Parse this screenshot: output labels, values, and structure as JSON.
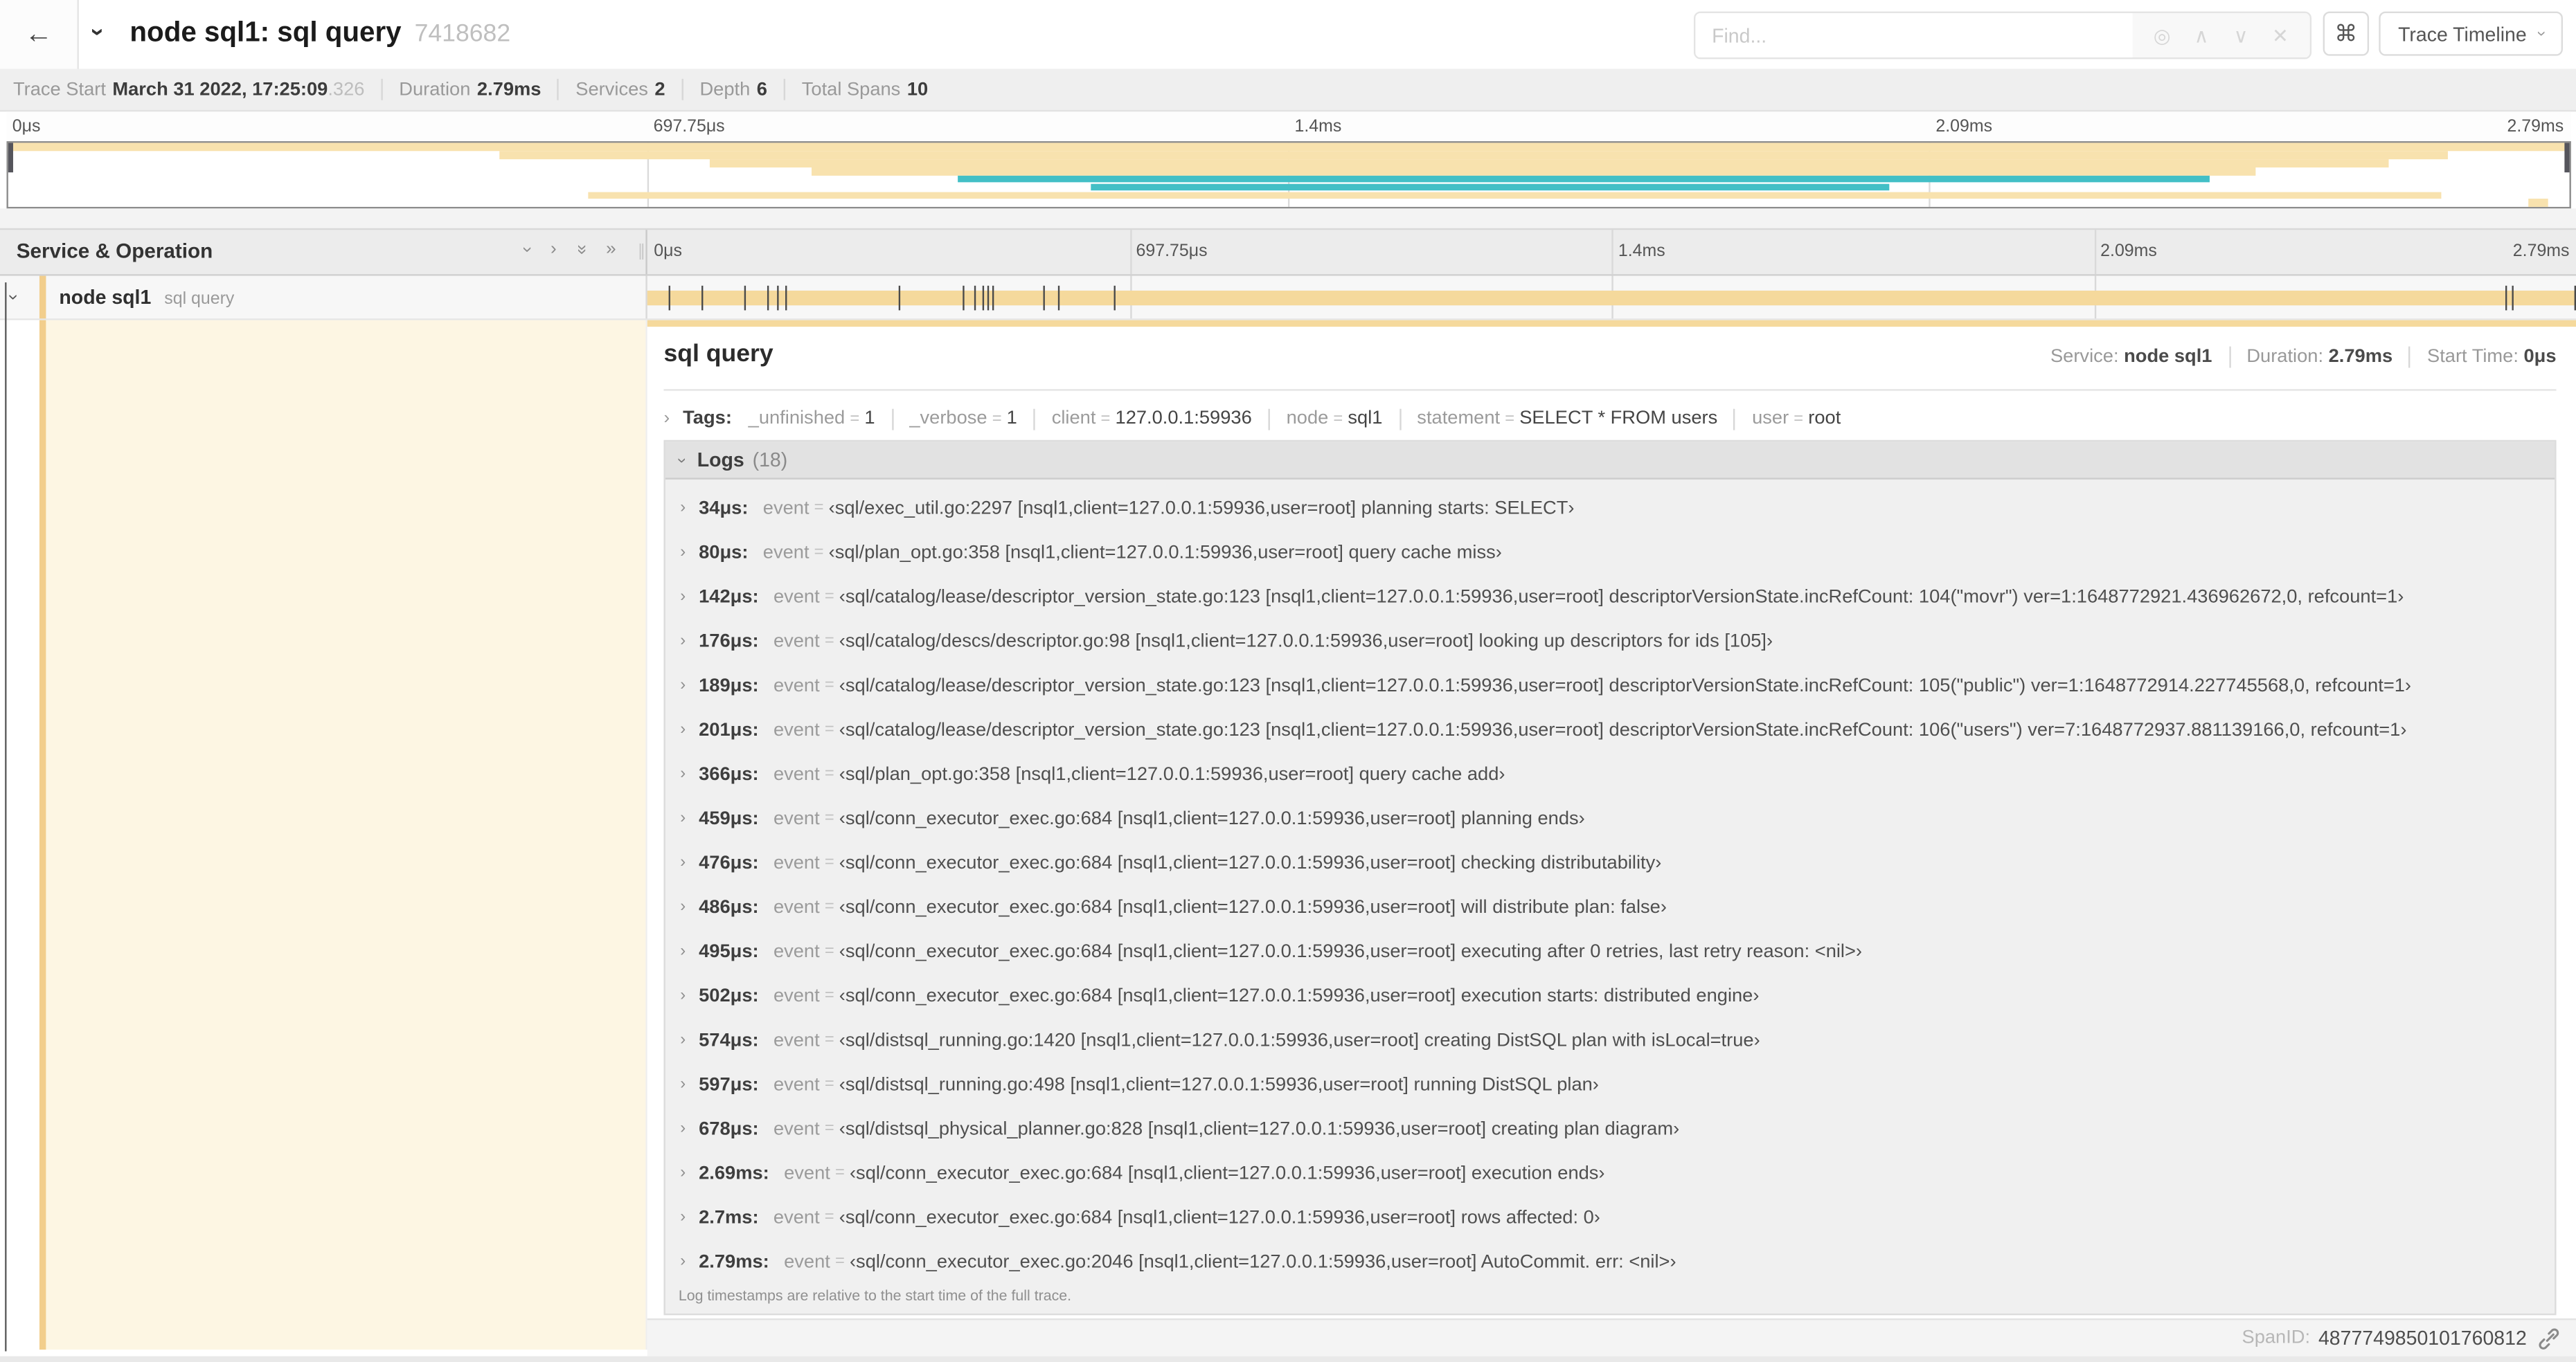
{
  "colors": {
    "span_bar": "#F5D99C",
    "minimap_tan": "#F8E2AE",
    "teal": "#43BFC6",
    "detail_row_bg": "#FDF6E3",
    "accent_bar": "#F2CE8C"
  },
  "header": {
    "back_icon": "←",
    "title": "node sql1: sql query",
    "trace_id": "7418682",
    "find": {
      "placeholder": "Find...",
      "icons": [
        "◎",
        "∧",
        "∨",
        "✕"
      ]
    },
    "shortcuts_button": "⌘",
    "view_button": {
      "label": "Trace Timeline"
    }
  },
  "summary": {
    "items": [
      {
        "label": "Trace Start",
        "value": "March 31 2022, 17:25:09",
        "suffix": ".326"
      },
      {
        "label": "Duration",
        "value": "2.79ms"
      },
      {
        "label": "Services",
        "value": "2"
      },
      {
        "label": "Depth",
        "value": "6"
      },
      {
        "label": "Total Spans",
        "value": "10"
      }
    ]
  },
  "minimap": {
    "tick_labels": [
      "0μs",
      "697.75μs",
      "1.4ms",
      "2.09ms",
      "2.79ms"
    ],
    "gridlines_pct": [
      25,
      50,
      75
    ],
    "spans": [
      {
        "row": 0,
        "start_pct": 0,
        "end_pct": 100,
        "color": "tan"
      },
      {
        "row": 1,
        "start_pct": 19.2,
        "end_pct": 95.3,
        "color": "tan"
      },
      {
        "row": 2,
        "start_pct": 27.4,
        "end_pct": 93.0,
        "color": "tan"
      },
      {
        "row": 3,
        "start_pct": 31.4,
        "end_pct": 87.8,
        "color": "tan"
      },
      {
        "row": 4,
        "start_pct": 37.1,
        "end_pct": 86.0,
        "color": "teal"
      },
      {
        "row": 5,
        "start_pct": 42.3,
        "end_pct": 73.5,
        "color": "teal"
      },
      {
        "row": 6,
        "start_pct": 22.7,
        "end_pct": 95.0,
        "color": "tan"
      },
      {
        "row": 7,
        "start_pct": 98.4,
        "end_pct": 99.2,
        "color": "tan"
      }
    ]
  },
  "timeline": {
    "column_header": "Service & Operation",
    "collapse_icons": [
      {
        "name": "collapse-level-icon",
        "glyph": "›",
        "rotate": true
      },
      {
        "name": "expand-level-icon",
        "glyph": "›",
        "rotate": false
      },
      {
        "name": "collapse-all-icon",
        "glyph": "»",
        "rotate": true
      },
      {
        "name": "expand-all-icon",
        "glyph": "»",
        "rotate": false
      }
    ],
    "tick_labels": [
      "0μs",
      "697.75μs",
      "1.4ms",
      "2.09ms",
      "2.79ms"
    ],
    "gridlines_pct": [
      25,
      50,
      75
    ]
  },
  "span_row": {
    "service": "node sql1",
    "operation": "sql query",
    "duration_us": 2790,
    "log_marker_times_us": [
      34,
      80,
      142,
      176,
      189,
      201,
      366,
      459,
      476,
      486,
      495,
      502,
      574,
      597,
      678,
      2690,
      2700,
      2790
    ]
  },
  "detail": {
    "title": "sql query",
    "meta": [
      {
        "label": "Service:",
        "value": "node sql1"
      },
      {
        "label": "Duration:",
        "value": "2.79ms"
      },
      {
        "label": "Start Time:",
        "value": "0μs"
      }
    ],
    "tags_label": "Tags:",
    "tags": [
      {
        "key": "_unfinished",
        "value": "1"
      },
      {
        "key": "_verbose",
        "value": "1"
      },
      {
        "key": "client",
        "value": "127.0.0.1:59936"
      },
      {
        "key": "node",
        "value": "sql1"
      },
      {
        "key": "statement",
        "value": "SELECT * FROM users"
      },
      {
        "key": "user",
        "value": "root"
      }
    ],
    "logs_label": "Logs",
    "logs_count": "(18)",
    "logs": [
      {
        "time": "34μs:",
        "field": "event",
        "value": "‹sql/exec_util.go:2297 [nsql1,client=127.0.0.1:59936,user=root] planning starts: SELECT›"
      },
      {
        "time": "80μs:",
        "field": "event",
        "value": "‹sql/plan_opt.go:358 [nsql1,client=127.0.0.1:59936,user=root] query cache miss›"
      },
      {
        "time": "142μs:",
        "field": "event",
        "value": "‹sql/catalog/lease/descriptor_version_state.go:123 [nsql1,client=127.0.0.1:59936,user=root] descriptorVersionState.incRefCount: 104(\"movr\") ver=1:1648772921.436962672,0, refcount=1›"
      },
      {
        "time": "176μs:",
        "field": "event",
        "value": "‹sql/catalog/descs/descriptor.go:98 [nsql1,client=127.0.0.1:59936,user=root] looking up descriptors for ids [105]›"
      },
      {
        "time": "189μs:",
        "field": "event",
        "value": "‹sql/catalog/lease/descriptor_version_state.go:123 [nsql1,client=127.0.0.1:59936,user=root] descriptorVersionState.incRefCount: 105(\"public\") ver=1:1648772914.227745568,0, refcount=1›"
      },
      {
        "time": "201μs:",
        "field": "event",
        "value": "‹sql/catalog/lease/descriptor_version_state.go:123 [nsql1,client=127.0.0.1:59936,user=root] descriptorVersionState.incRefCount: 106(\"users\") ver=7:1648772937.881139166,0, refcount=1›"
      },
      {
        "time": "366μs:",
        "field": "event",
        "value": "‹sql/plan_opt.go:358 [nsql1,client=127.0.0.1:59936,user=root] query cache add›"
      },
      {
        "time": "459μs:",
        "field": "event",
        "value": "‹sql/conn_executor_exec.go:684 [nsql1,client=127.0.0.1:59936,user=root] planning ends›"
      },
      {
        "time": "476μs:",
        "field": "event",
        "value": "‹sql/conn_executor_exec.go:684 [nsql1,client=127.0.0.1:59936,user=root] checking distributability›"
      },
      {
        "time": "486μs:",
        "field": "event",
        "value": "‹sql/conn_executor_exec.go:684 [nsql1,client=127.0.0.1:59936,user=root] will distribute plan: false›"
      },
      {
        "time": "495μs:",
        "field": "event",
        "value": "‹sql/conn_executor_exec.go:684 [nsql1,client=127.0.0.1:59936,user=root] executing after 0 retries, last retry reason: <nil>›"
      },
      {
        "time": "502μs:",
        "field": "event",
        "value": "‹sql/conn_executor_exec.go:684 [nsql1,client=127.0.0.1:59936,user=root] execution starts: distributed engine›"
      },
      {
        "time": "574μs:",
        "field": "event",
        "value": "‹sql/distsql_running.go:1420 [nsql1,client=127.0.0.1:59936,user=root] creating DistSQL plan with isLocal=true›"
      },
      {
        "time": "597μs:",
        "field": "event",
        "value": "‹sql/distsql_running.go:498 [nsql1,client=127.0.0.1:59936,user=root] running DistSQL plan›"
      },
      {
        "time": "678μs:",
        "field": "event",
        "value": "‹sql/distsql_physical_planner.go:828 [nsql1,client=127.0.0.1:59936,user=root] creating plan diagram›"
      },
      {
        "time": "2.69ms:",
        "field": "event",
        "value": "‹sql/conn_executor_exec.go:684 [nsql1,client=127.0.0.1:59936,user=root] execution ends›"
      },
      {
        "time": "2.7ms:",
        "field": "event",
        "value": "‹sql/conn_executor_exec.go:684 [nsql1,client=127.0.0.1:59936,user=root] rows affected: 0›"
      },
      {
        "time": "2.79ms:",
        "field": "event",
        "value": "‹sql/conn_executor_exec.go:2046 [nsql1,client=127.0.0.1:59936,user=root] AutoCommit. err: <nil>›"
      }
    ],
    "logs_note": "Log timestamps are relative to the start time of the full trace.",
    "span_id_label": "SpanID:",
    "span_id": "4877749850101760812"
  }
}
